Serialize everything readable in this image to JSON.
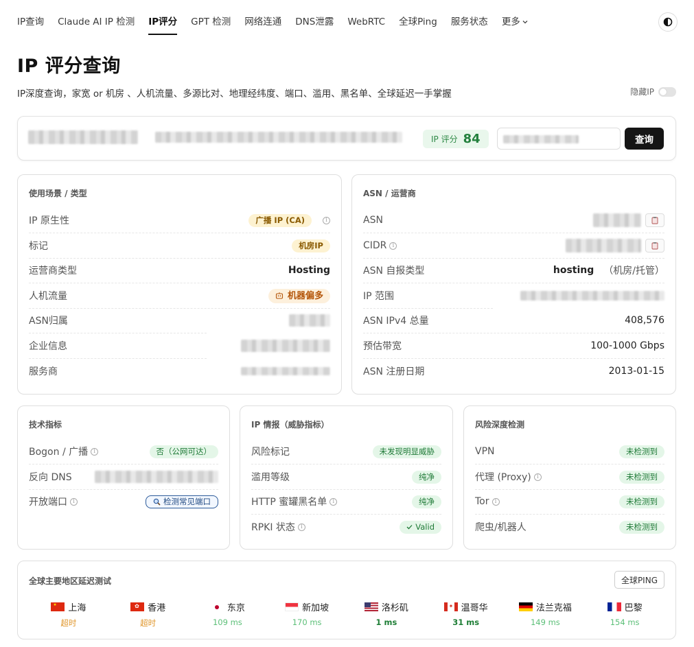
{
  "nav": {
    "items": [
      {
        "label": "IP查询",
        "active": false
      },
      {
        "label": "Claude AI IP 检测",
        "active": false
      },
      {
        "label": "IP评分",
        "active": true
      },
      {
        "label": "GPT 检测",
        "active": false
      },
      {
        "label": "网络连通",
        "active": false
      },
      {
        "label": "DNS泄露",
        "active": false
      },
      {
        "label": "WebRTC",
        "active": false
      },
      {
        "label": "全球Ping",
        "active": false
      },
      {
        "label": "服务状态",
        "active": false
      }
    ],
    "more_label": "更多"
  },
  "header": {
    "title": "IP 评分查询",
    "subtitle": "IP深度查询，家宽 or 机房 、人机流量、多源比对、地理经纬度、端口、滥用、黑名单、全球延迟一手掌握",
    "hide_ip_label": "隐藏IP"
  },
  "search": {
    "score_label": "IP 评分",
    "score_value": "84",
    "query_button": "查询"
  },
  "usage_card": {
    "title": "使用场景 / 类型",
    "rows": {
      "native": {
        "label": "IP 原生性",
        "value": "广播 IP (CA)"
      },
      "tag": {
        "label": "标记",
        "value": "机房IP"
      },
      "isp_type": {
        "label": "运营商类型",
        "value": "Hosting"
      },
      "traffic": {
        "label": "人机流量",
        "value": "机器偏多"
      },
      "asn_owner": {
        "label": "ASN归属"
      },
      "org": {
        "label": "企业信息"
      },
      "provider": {
        "label": "服务商"
      }
    }
  },
  "asn_card": {
    "title": "ASN / 运营商",
    "rows": {
      "asn": {
        "label": "ASN"
      },
      "cidr": {
        "label": "CIDR"
      },
      "asn_type": {
        "label": "ASN 自报类型",
        "value": "hosting",
        "note": "（机房/托管）"
      },
      "ip_range": {
        "label": "IP 范围"
      },
      "ipv4_total": {
        "label": "ASN IPv4 总量",
        "value": "408,576"
      },
      "bandwidth": {
        "label": "预估带宽",
        "value": "100-1000 Gbps"
      },
      "reg_date": {
        "label": "ASN 注册日期",
        "value": "2013-01-15"
      }
    }
  },
  "tech_card": {
    "title": "技术指标",
    "rows": {
      "bogon": {
        "label": "Bogon / 广播",
        "value": "否（公网可达）"
      },
      "rdns": {
        "label": "反向 DNS"
      },
      "ports": {
        "label": "开放端口",
        "value": "检测常见端口"
      }
    }
  },
  "intel_card": {
    "title": "IP 情报（威胁指标）",
    "rows": {
      "risk": {
        "label": "风险标记",
        "value": "未发现明显威胁"
      },
      "abuse": {
        "label": "滥用等级",
        "value": "纯净"
      },
      "honeypot": {
        "label": "HTTP 蜜罐黑名单",
        "value": "纯净"
      },
      "rpki": {
        "label": "RPKI 状态",
        "value": "Valid"
      }
    }
  },
  "risk_card": {
    "title": "风险深度检测",
    "rows": {
      "vpn": {
        "label": "VPN",
        "value": "未检测到"
      },
      "proxy": {
        "label": "代理 (Proxy)",
        "value": "未检测到"
      },
      "tor": {
        "label": "Tor",
        "value": "未检测到"
      },
      "crawler": {
        "label": "爬虫/机器人",
        "value": "未检测到"
      }
    }
  },
  "latency_card": {
    "title": "全球主要地区延迟测试",
    "ping_button": "全球PING",
    "regions": [
      {
        "name": "上海",
        "latency": "超时",
        "flag": "cn"
      },
      {
        "name": "香港",
        "latency": "超时",
        "flag": "hk"
      },
      {
        "name": "东京",
        "latency": "109 ms",
        "flag": "jp"
      },
      {
        "name": "新加坡",
        "latency": "170 ms",
        "flag": "sg"
      },
      {
        "name": "洛杉矶",
        "latency": "1 ms",
        "flag": "us"
      },
      {
        "name": "温哥华",
        "latency": "31 ms",
        "flag": "ca"
      },
      {
        "name": "法兰克福",
        "latency": "149 ms",
        "flag": "de"
      },
      {
        "name": "巴黎",
        "latency": "154 ms",
        "flag": "fr"
      }
    ]
  }
}
